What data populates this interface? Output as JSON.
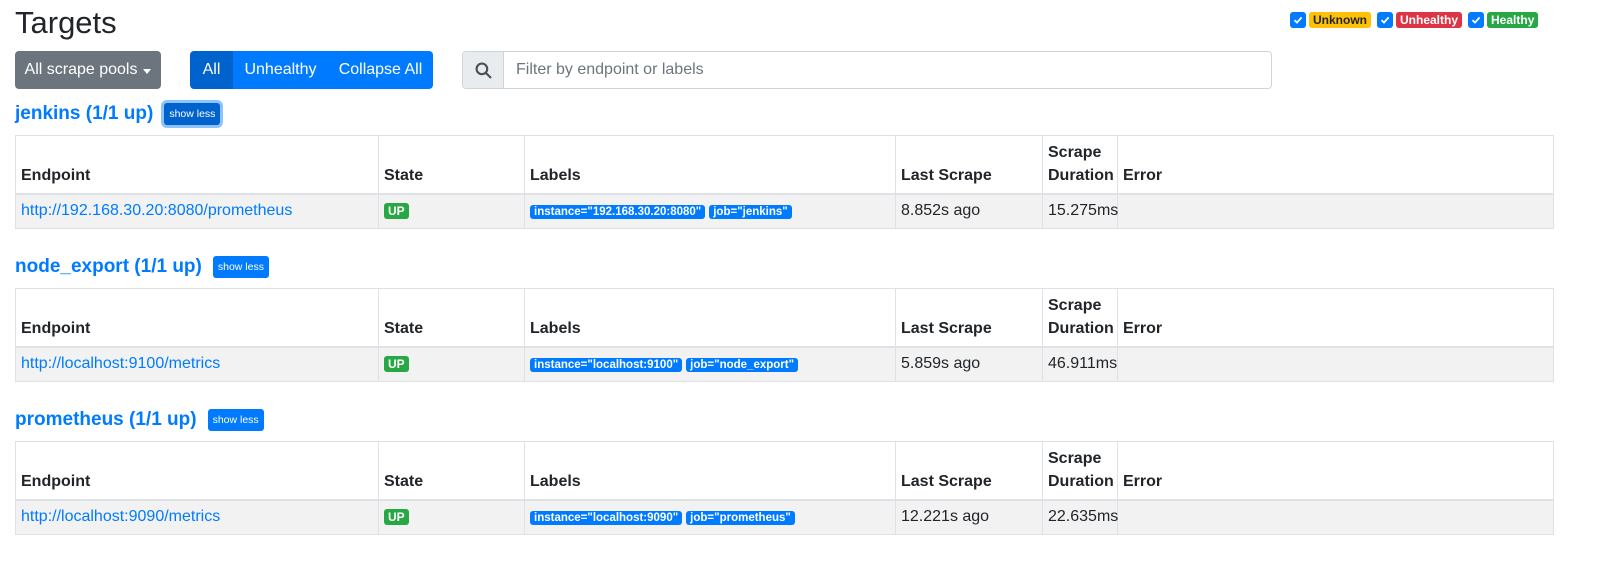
{
  "page": {
    "title": "Targets"
  },
  "toolbar": {
    "pool_dropdown": "All scrape pools",
    "buttons": {
      "all": "All",
      "unhealthy": "Unhealthy",
      "collapse": "Collapse All"
    },
    "search_placeholder": "Filter by endpoint or labels"
  },
  "filters": [
    {
      "label": "Unknown",
      "checked": true,
      "color": "#ffc107"
    },
    {
      "label": "Unhealthy",
      "checked": true,
      "color": "#dc3545"
    },
    {
      "label": "Healthy",
      "checked": true,
      "color": "#28a745"
    }
  ],
  "columns": {
    "endpoint": "Endpoint",
    "state": "State",
    "labels": "Labels",
    "last_scrape": "Last Scrape",
    "scrape": "Scrape",
    "duration": "Duration",
    "error": "Error"
  },
  "pools": [
    {
      "title": "jenkins (1/1 up)",
      "toggle": "show less",
      "endpoint": "http://192.168.30.20:8080/prometheus",
      "state": "UP",
      "labels": [
        "instance=\"192.168.30.20:8080\"",
        "job=\"jenkins\""
      ],
      "last_scrape": "8.852s ago",
      "duration": "15.275ms",
      "error": ""
    },
    {
      "title": "node_export (1/1 up)",
      "toggle": "show less",
      "endpoint": "http://localhost:9100/metrics",
      "state": "UP",
      "labels": [
        "instance=\"localhost:9100\"",
        "job=\"node_export\""
      ],
      "last_scrape": "5.859s ago",
      "duration": "46.911ms",
      "error": ""
    },
    {
      "title": "prometheus (1/1 up)",
      "toggle": "show less",
      "endpoint": "http://localhost:9090/metrics",
      "state": "UP",
      "labels": [
        "instance=\"localhost:9090\"",
        "job=\"prometheus\""
      ],
      "last_scrape": "12.221s ago",
      "duration": "22.635ms",
      "error": ""
    }
  ],
  "colors": {
    "primary": "#007bff",
    "success": "#28a745",
    "secondary": "#6c757d"
  }
}
